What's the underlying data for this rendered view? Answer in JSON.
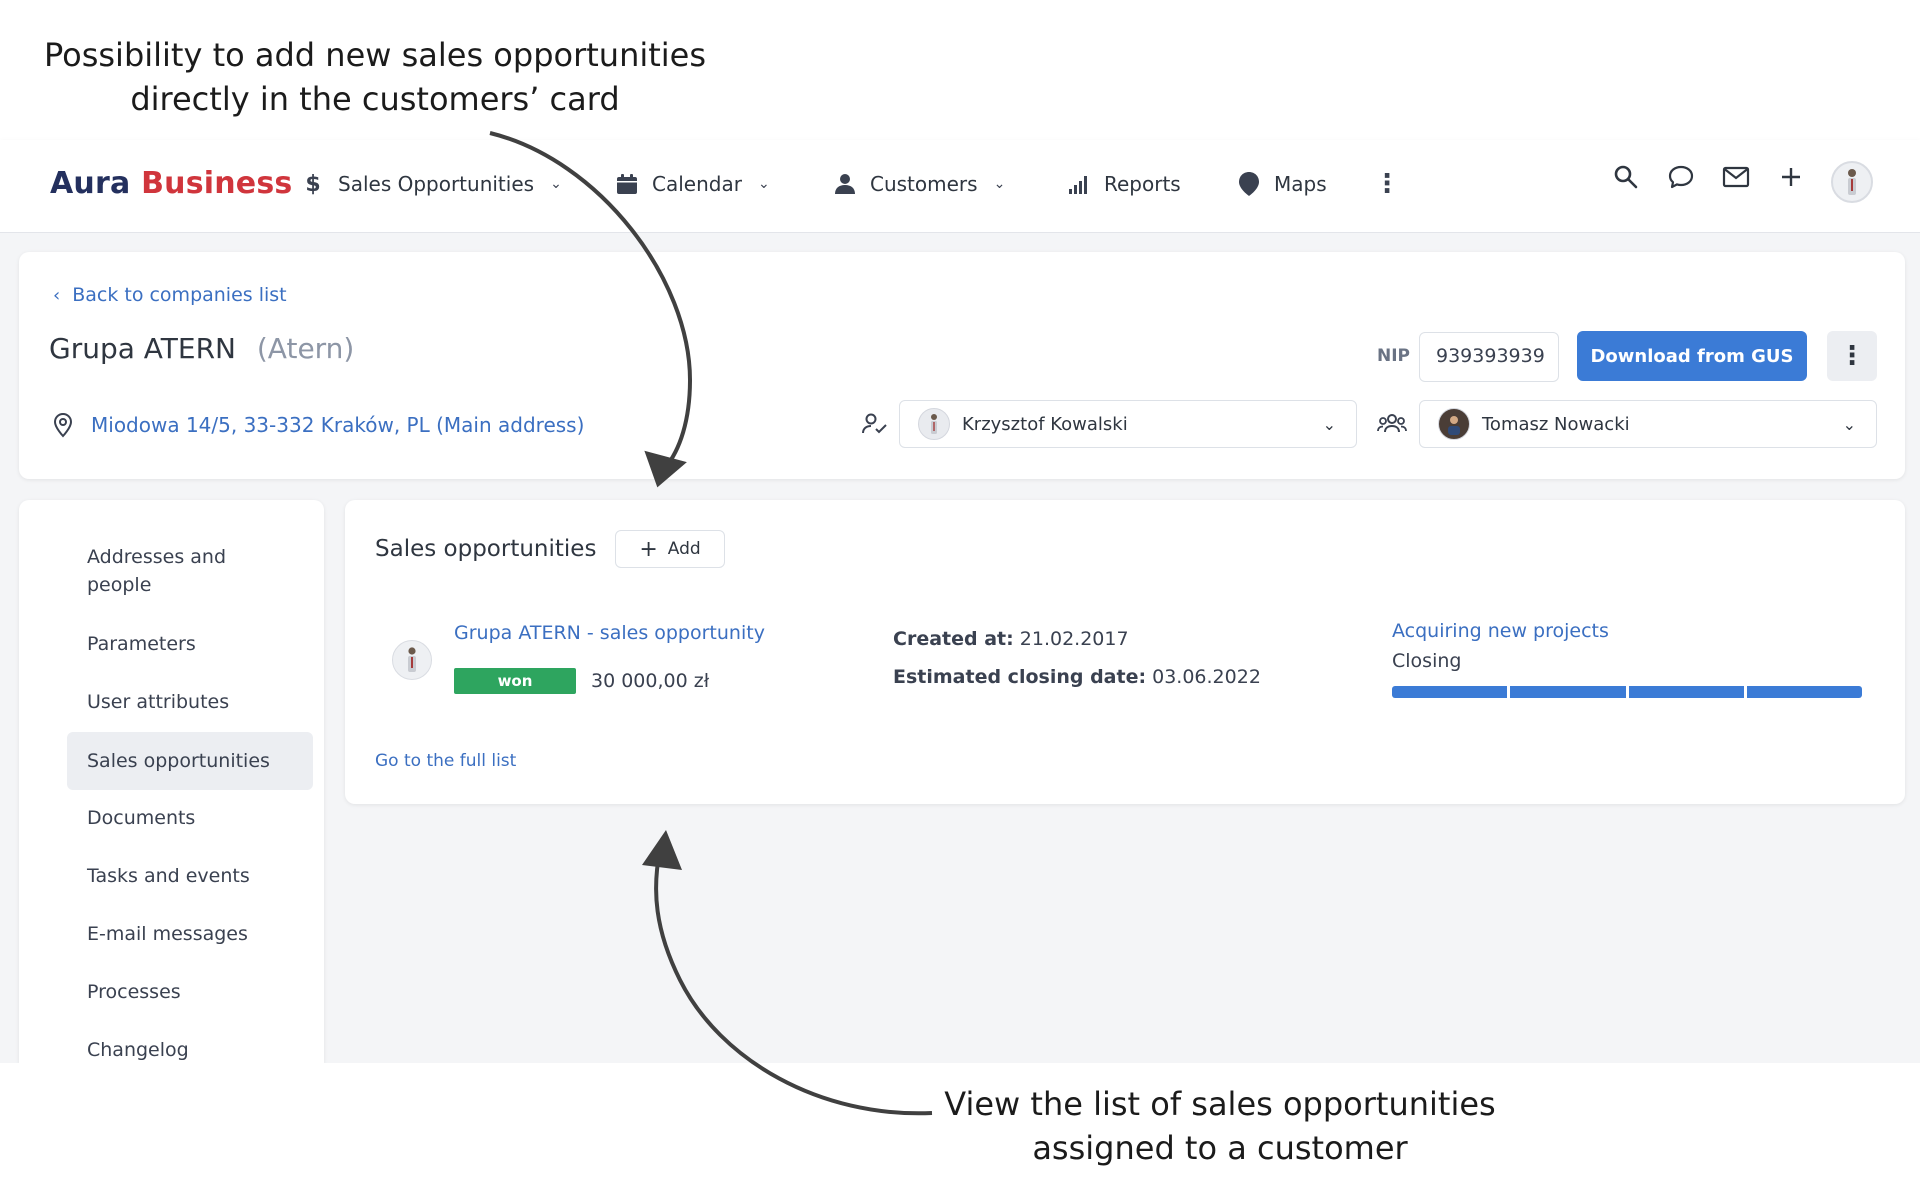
{
  "annotations": {
    "top_line1": "Possibility to add new sales opportunities",
    "top_line2": "directly in the customers’ card",
    "bottom_line1": "View the list of sales opportunities",
    "bottom_line2": "assigned to a customer"
  },
  "brand": {
    "part1": "Aura",
    "part2": "Business",
    "color_primary": "#24305e",
    "color_accent": "#d0353c"
  },
  "nav": {
    "items": [
      {
        "label": "Sales Opportunities",
        "icon": "dollar-icon"
      },
      {
        "label": "Calendar",
        "icon": "calendar-icon"
      },
      {
        "label": "Customers",
        "icon": "user-icon"
      },
      {
        "label": "Reports",
        "icon": "bar-chart-icon"
      },
      {
        "label": "Maps",
        "icon": "map-pin-icon"
      }
    ]
  },
  "header_card": {
    "back_link": "Back to companies list",
    "company_name": "Grupa ATERN",
    "company_short": "(Atern)",
    "address": "Miodowa 14/5, 33-332 Kraków, PL (Main address)",
    "nip_label": "NIP",
    "nip_value": "939393939",
    "download_button": "Download from GUS",
    "owner": "Krzysztof Kowalski",
    "team_member": "Tomasz Nowacki"
  },
  "sidebar": {
    "items": [
      {
        "line1": "Addresses and",
        "line2": "people"
      },
      {
        "line1": "Parameters"
      },
      {
        "line1": "User attributes"
      },
      {
        "line1": "Sales opportunities",
        "active": true
      },
      {
        "line1": "Documents"
      },
      {
        "line1": "Tasks and events"
      },
      {
        "line1": "E-mail messages"
      },
      {
        "line1": "Processes"
      },
      {
        "line1": "Changelog"
      }
    ]
  },
  "opportunities": {
    "section_title": "Sales opportunities",
    "add_button": "Add",
    "item": {
      "name": "Grupa ATERN - sales opportunity",
      "status": "won",
      "status_color": "#2ea55f",
      "amount": "30 000,00 zł",
      "created_label": "Created at:",
      "created_value": "21.02.2017",
      "closing_label": "Estimated closing date:",
      "closing_value": "03.06.2022",
      "process_name": "Acquiring new projects",
      "stage": "Closing",
      "progress_color": "#3b7bd6"
    },
    "full_list_link": "Go to the full list"
  }
}
